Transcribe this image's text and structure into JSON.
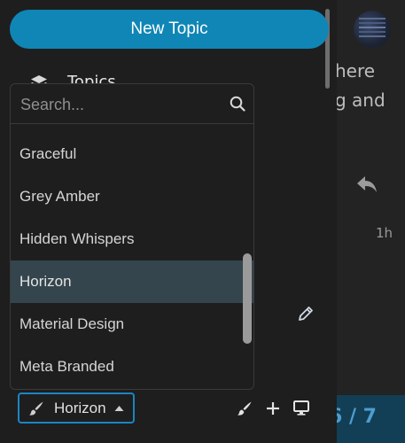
{
  "sidebar": {
    "new_topic_label": "New Topic",
    "topics_label": "Topics"
  },
  "dropdown": {
    "search_placeholder": "Search...",
    "options": [
      "Graceful",
      "Grey Amber",
      "Hidden Whispers",
      "Horizon",
      "Material Design",
      "Meta Branded"
    ],
    "selected": "Horizon"
  },
  "theme_selector": {
    "current": "Horizon"
  },
  "background": {
    "line1": "here",
    "line2": "g and",
    "time_ago": "1h",
    "progress": "6 / 7"
  },
  "colors": {
    "accent": "#0f86b6",
    "selected_option": "#34454d",
    "focus_border": "#1a86c0"
  },
  "icons": [
    "search-icon",
    "paintbrush-icon",
    "plus-icon",
    "desktop-icon",
    "reply-icon",
    "pencil-icon",
    "caret-up-icon",
    "layers-icon"
  ]
}
